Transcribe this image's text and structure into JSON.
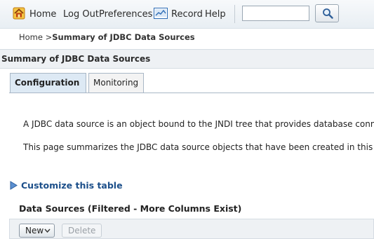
{
  "toolbar": {
    "home_label": "Home",
    "logout_label": "Log Out",
    "preferences_label": "Preferences",
    "record_label": "Record",
    "help_label": "Help",
    "search_value": ""
  },
  "breadcrumb": {
    "home": "Home >",
    "current": "Summary of JDBC Data Sources"
  },
  "page": {
    "title": "Summary of JDBC Data Sources"
  },
  "tabs": [
    {
      "label": "Configuration",
      "active": true
    },
    {
      "label": "Monitoring",
      "active": false
    }
  ],
  "content": {
    "paragraph_1": "A JDBC data source is an object bound to the JNDI tree that provides database conne",
    "paragraph_2": "This page summarizes the JDBC data source objects that have been created in this do",
    "customize_link": "Customize this table"
  },
  "table": {
    "title": "Data Sources (Filtered - More Columns Exist)",
    "new_button": "New",
    "delete_button": "Delete"
  }
}
